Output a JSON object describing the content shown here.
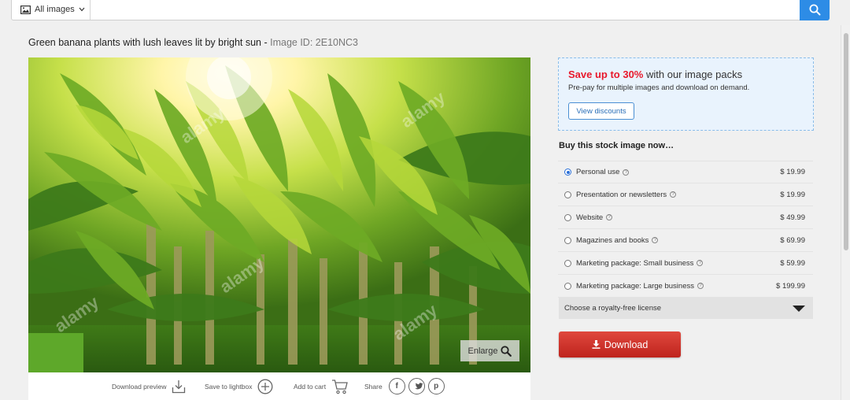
{
  "search": {
    "type_label": "All images",
    "placeholder": ""
  },
  "title": {
    "text": "Green banana plants with lush leaves lit by bright sun",
    "separator": " - ",
    "image_id_label": "Image ID: 2E10NC3"
  },
  "photo": {
    "watermark": "alamy",
    "enlarge_label": "Enlarge"
  },
  "actions": {
    "download_preview": "Download preview",
    "save_to_lightbox": "Save to lightbox",
    "add_to_cart": "Add to cart",
    "share": "Share"
  },
  "promo": {
    "highlight": "Save up to 30%",
    "headline_rest": " with our image packs",
    "subtext": "Pre-pay for multiple images and download on demand.",
    "button": "View discounts"
  },
  "buy": {
    "title": "Buy this stock image now…",
    "options": [
      {
        "label": "Personal use",
        "price": "$ 19.99",
        "selected": true
      },
      {
        "label": "Presentation or newsletters",
        "price": "$ 19.99",
        "selected": false
      },
      {
        "label": "Website",
        "price": "$ 49.99",
        "selected": false
      },
      {
        "label": "Magazines and books",
        "price": "$ 69.99",
        "selected": false
      },
      {
        "label": "Marketing package: Small business",
        "price": "$ 59.99",
        "selected": false
      },
      {
        "label": "Marketing package: Large business",
        "price": "$ 199.99",
        "selected": false
      }
    ],
    "royalty_free": "Choose a royalty-free license",
    "download_button": "Download"
  },
  "colors": {
    "accent_blue": "#2d8ce6",
    "promo_red": "#e8192c",
    "download_red": "#d0332b"
  }
}
